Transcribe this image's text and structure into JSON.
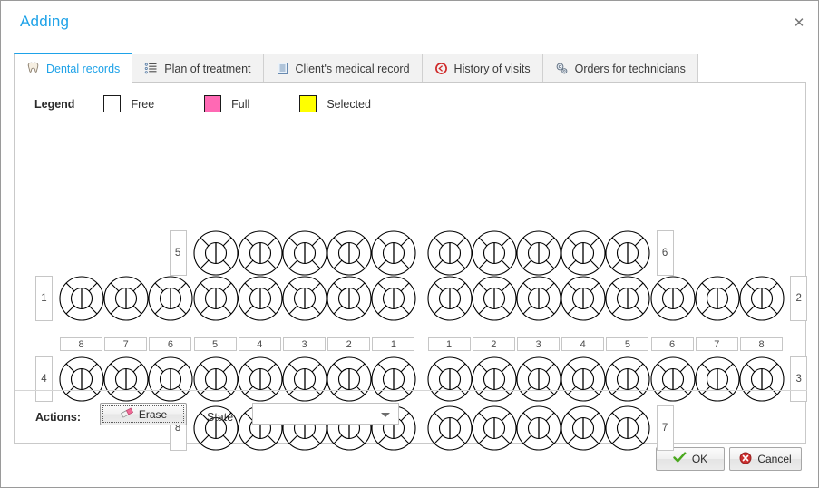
{
  "window": {
    "title": "Adding",
    "close_icon": "close-icon",
    "title_color": "#1ea2e8"
  },
  "tabs": [
    {
      "label": "Dental records",
      "icon": "tooth-icon",
      "active": true
    },
    {
      "label": "Plan of treatment",
      "icon": "list-icon",
      "active": false
    },
    {
      "label": "Client's medical record",
      "icon": "document-icon",
      "active": false
    },
    {
      "label": "History of visits",
      "icon": "history-icon",
      "active": false
    },
    {
      "label": "Orders for technicians",
      "icon": "gears-icon",
      "active": false
    }
  ],
  "legend": {
    "label": "Legend",
    "items": [
      {
        "label": "Free",
        "color": "#ffffff"
      },
      {
        "label": "Full",
        "color": "#ff69b4"
      },
      {
        "label": "Selected",
        "color": "#ffff00"
      }
    ]
  },
  "chart": {
    "quadrant_labels": {
      "upper_primary_left": "5",
      "upper_primary_right": "6",
      "upper_permanent_left": "1",
      "upper_permanent_right": "2",
      "lower_permanent_left": "4",
      "lower_permanent_right": "3",
      "lower_primary_left": "8",
      "lower_primary_right": "7"
    },
    "tooth_numbers_left": [
      "8",
      "7",
      "6",
      "5",
      "4",
      "3",
      "2",
      "1"
    ],
    "tooth_numbers_right": [
      "1",
      "2",
      "3",
      "4",
      "5",
      "6",
      "7",
      "8"
    ],
    "rows": [
      {
        "name": "upper-primary",
        "left_count": 5,
        "right_count": 5
      },
      {
        "name": "upper-permanent",
        "left_count": 8,
        "right_count": 8
      },
      {
        "name": "lower-permanent",
        "left_count": 8,
        "right_count": 8
      },
      {
        "name": "lower-primary",
        "left_count": 5,
        "right_count": 5
      }
    ],
    "tooth_state": "free"
  },
  "actions": {
    "label": "Actions:",
    "erase_label": "Erase",
    "erase_icon": "eraser-icon",
    "state_label": "State",
    "state_value": "",
    "state_placeholder": ""
  },
  "footer": {
    "ok_label": "OK",
    "ok_icon": "check-icon",
    "cancel_label": "Cancel",
    "cancel_icon": "cancel-icon"
  }
}
